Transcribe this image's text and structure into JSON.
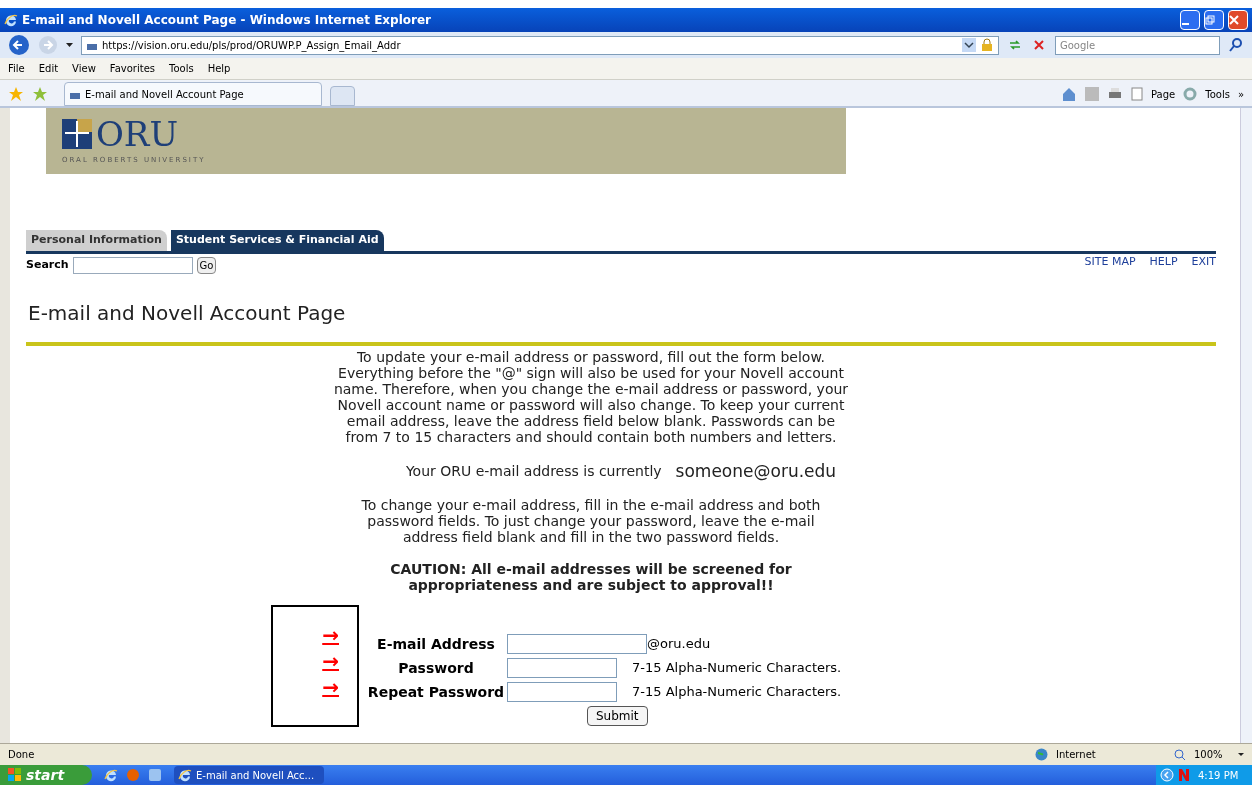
{
  "window": {
    "title": "E-mail and Novell Account Page - Windows Internet Explorer"
  },
  "address_bar": {
    "url": "https://vision.oru.edu/pls/prod/ORUWP.P_Assign_Email_Addr",
    "search_placeholder": "Google"
  },
  "menu": [
    "File",
    "Edit",
    "View",
    "Favorites",
    "Tools",
    "Help"
  ],
  "browser_tab": {
    "label": "E-mail and Novell Account Page"
  },
  "command_bar": {
    "page": "Page",
    "tools": "Tools",
    "more": "»"
  },
  "page": {
    "logo": {
      "text": "ORU",
      "subtitle": "ORAL ROBERTS UNIVERSITY"
    },
    "tabs": [
      {
        "label": "Personal Information",
        "selected": false
      },
      {
        "label": "Student Services & Financial Aid",
        "selected": true
      }
    ],
    "search": {
      "label": "Search",
      "button": "Go"
    },
    "links": [
      "SITE MAP",
      "HELP",
      "EXIT"
    ],
    "heading": "E-mail and Novell Account Page",
    "intro": "To update your e-mail address or password, fill out the form below. Everything before the \"@\" sign will also be used for your Novell account name. Therefore, when you change the e-mail address or password, your Novell account name or password will also change. To keep your current email address, leave the address field below blank. Passwords can be from 7 to 15 characters and should contain both numbers and letters.",
    "current_label": "Your ORU e-mail address is currently",
    "current_value": "someone@oru.edu",
    "instructions": "To change your e-mail address, fill in the e-mail address and both password fields. To just change your password, leave the e-mail address field blank and fill in the two password fields.",
    "caution": "CAUTION: All e-mail addresses will be screened for appropriateness and are subject to approval!!",
    "fields": [
      {
        "arrow": "→",
        "label": "E-mail Address",
        "suffix": "@oru.edu",
        "wide": true
      },
      {
        "arrow": "→",
        "label": "Password",
        "suffix": "7-15 Alpha-Numeric Characters.",
        "wide": false
      },
      {
        "arrow": "→",
        "label": "Repeat Password",
        "suffix": "7-15 Alpha-Numeric Characters.",
        "wide": false
      }
    ],
    "submit": "Submit"
  },
  "status_bar": {
    "text": "Done",
    "zone": "Internet",
    "zoom": "100%"
  },
  "taskbar": {
    "start": "start",
    "task": "E-mail and Novell Acc...",
    "clock": "4:19 PM"
  }
}
